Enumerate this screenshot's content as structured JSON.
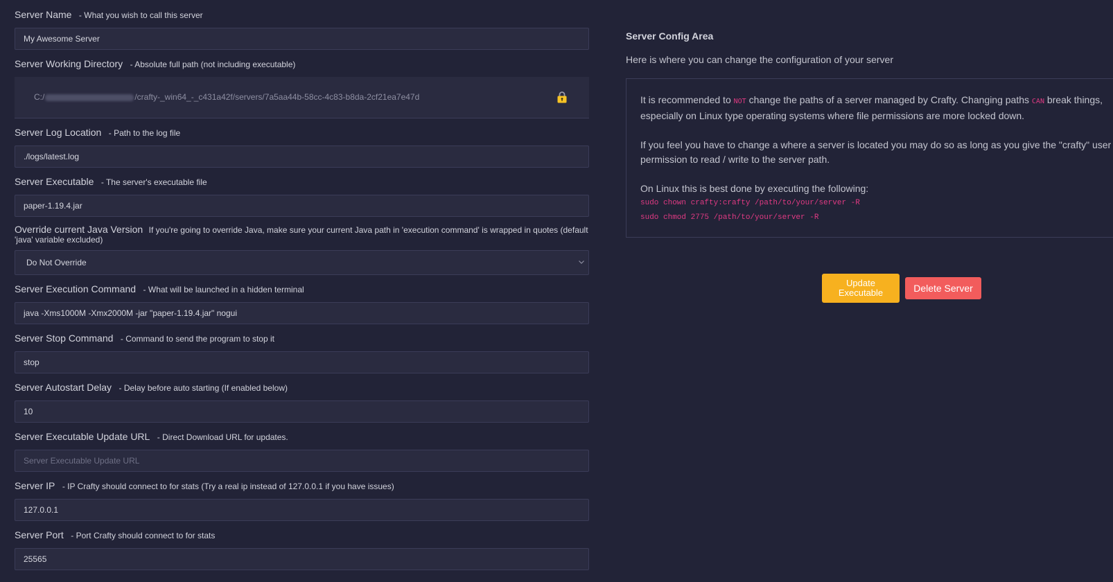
{
  "form": {
    "server_name": {
      "label": "Server Name",
      "hint": "- What you wish to call this server",
      "value": "My Awesome Server"
    },
    "working_dir": {
      "label": "Server Working Directory",
      "hint": "- Absolute full path (not including executable)",
      "prefix": "C:/",
      "suffix": "/crafty-_win64_-_c431a42f/servers/7a5aa44b-58cc-4c83-b8da-2cf21ea7e47d"
    },
    "log_location": {
      "label": "Server Log Location",
      "hint": "- Path to the log file",
      "value": "./logs/latest.log"
    },
    "executable": {
      "label": "Server Executable",
      "hint": "- The server's executable file",
      "value": "paper-1.19.4.jar"
    },
    "java_override": {
      "label": "Override current Java Version",
      "hint": "If you're going to override Java, make sure your current Java path in 'execution command' is wrapped in quotes (default 'java' variable excluded)",
      "selected": "Do Not Override"
    },
    "exec_command": {
      "label": "Server Execution Command",
      "hint": "- What will be launched in a hidden terminal",
      "value": "java -Xms1000M -Xmx2000M -jar \"paper-1.19.4.jar\" nogui"
    },
    "stop_command": {
      "label": "Server Stop Command",
      "hint": "- Command to send the program to stop it",
      "value": "stop"
    },
    "autostart_delay": {
      "label": "Server Autostart Delay",
      "hint": "- Delay before auto starting (If enabled below)",
      "value": "10"
    },
    "update_url": {
      "label": "Server Executable Update URL",
      "hint": "- Direct Download URL for updates.",
      "value": "",
      "placeholder": "Server Executable Update URL"
    },
    "server_ip": {
      "label": "Server IP",
      "hint": "- IP Crafty should connect to for stats (Try a real ip instead of 127.0.0.1 if you have issues)",
      "value": "127.0.0.1"
    },
    "server_port": {
      "label": "Server Port",
      "hint": "- Port Crafty should connect to for stats",
      "value": "25565"
    }
  },
  "config_area": {
    "title": "Server Config Area",
    "subtitle": "Here is where you can change the configuration of your server",
    "p1_a": "It is recommended to ",
    "p1_kbd1": "not",
    "p1_b": " change the paths of a server managed by Crafty. Changing paths ",
    "p1_kbd2": "can",
    "p1_c": " break things, especially on Linux type operating systems where file permissions are more locked down.",
    "p2": "If you feel you have to change a where a server is located you may do so as long as you give the \"crafty\" user permission to read / write to the server path.",
    "p3": "On Linux this is best done by executing the following:",
    "code1": "sudo chown crafty:crafty /path/to/your/server -R",
    "code2": "sudo chmod 2775 /path/to/your/server -R"
  },
  "buttons": {
    "update_line1": "Update",
    "update_line2": "Executable",
    "delete": "Delete Server"
  },
  "colors": {
    "update": "#f7b11f",
    "delete": "#f25c5c",
    "accent_code": "#e03a83"
  }
}
